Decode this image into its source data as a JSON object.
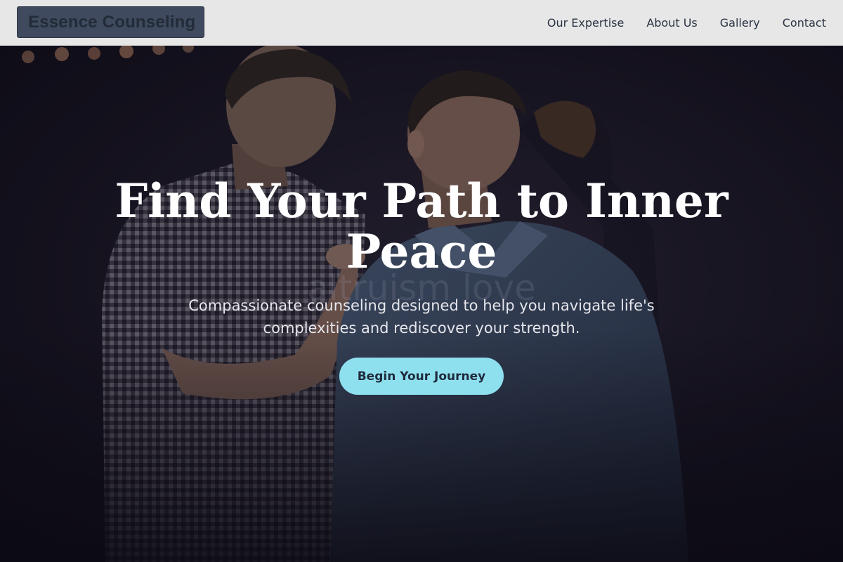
{
  "header": {
    "brand": "Essence Counseling",
    "nav": [
      "Our Expertise",
      "About Us",
      "Gallery",
      "Contact"
    ]
  },
  "hero": {
    "title_line1": "Find Your Path to Inner",
    "title_line2": "Peace",
    "watermark": "altruism love",
    "subtitle_line1": "Compassionate counseling designed to help you navigate life's",
    "subtitle_line2": "complexities and rediscover your strength.",
    "cta_label": "Begin Your Journey"
  },
  "colors": {
    "header_bg": "#e7e7e8",
    "brand_bg": "#3f4a5e",
    "brand_text": "#232a38",
    "nav_text": "#2a3342",
    "hero_overlay": "#0f0c1c",
    "cta_bg": "#8fe0ef",
    "cta_text": "#1f2a3c"
  }
}
